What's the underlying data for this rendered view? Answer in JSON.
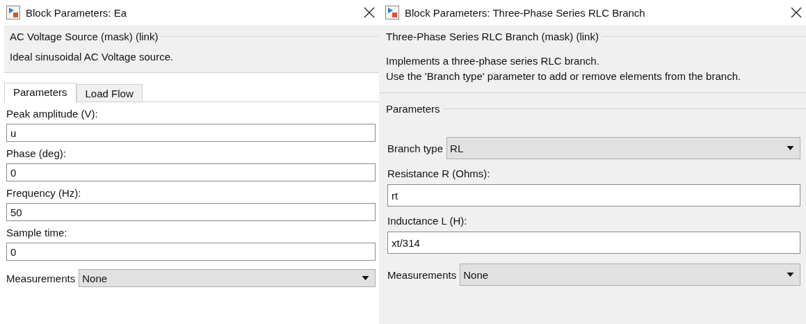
{
  "windows": [
    {
      "title": "Block Parameters: Ea",
      "mask_title": "AC Voltage Source (mask) (link)",
      "description": [
        "Ideal sinusoidal AC Voltage source."
      ],
      "tabs": [
        {
          "label": "Parameters",
          "selected": true
        },
        {
          "label": "Load Flow",
          "selected": false
        }
      ],
      "params": [
        {
          "kind": "text",
          "label": "Peak amplitude (V):",
          "value": "u"
        },
        {
          "kind": "text",
          "label": "Phase (deg):",
          "value": "0"
        },
        {
          "kind": "text",
          "label": "Frequency (Hz):",
          "value": "50"
        },
        {
          "kind": "text",
          "label": "Sample time:",
          "value": "0"
        },
        {
          "kind": "dropdown",
          "label": "Measurements",
          "value": "None"
        }
      ]
    },
    {
      "title": "Block Parameters: Three-Phase Series RLC Branch",
      "mask_title": "Three-Phase Series RLC Branch (mask) (link)",
      "description": [
        "Implements a three-phase series RLC branch.",
        "Use the 'Branch type' parameter to add or remove elements from the branch."
      ],
      "section": "Parameters",
      "params": [
        {
          "kind": "dropdown",
          "label": "Branch type",
          "value": "RL"
        },
        {
          "kind": "text",
          "label": "Resistance R (Ohms):",
          "value": "rt"
        },
        {
          "kind": "text",
          "label": "Inductance L (H):",
          "value": "xt/314"
        },
        {
          "kind": "dropdown",
          "label": "Measurements",
          "value": "None"
        }
      ]
    }
  ]
}
